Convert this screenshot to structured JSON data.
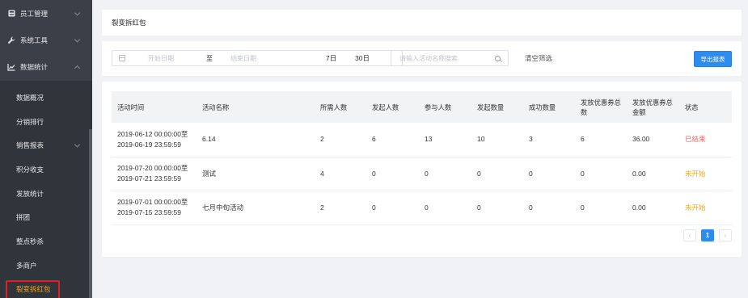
{
  "sidebar": {
    "top_items": [
      {
        "label": "员工管理",
        "icon": "id-card-icon"
      },
      {
        "label": "系统工具",
        "icon": "wrench-icon"
      },
      {
        "label": "数据统计",
        "icon": "chart-icon"
      }
    ],
    "sub_items": [
      {
        "label": "数据概况"
      },
      {
        "label": "分销排行"
      },
      {
        "label": "销售报表"
      },
      {
        "label": "积分收支"
      },
      {
        "label": "发放统计"
      },
      {
        "label": "拼团"
      },
      {
        "label": "整点秒杀"
      },
      {
        "label": "多商户"
      },
      {
        "label": "裂变拆红包"
      }
    ]
  },
  "page_title": "裂变拆红包",
  "filters": {
    "start_placeholder": "开始日期",
    "range_separator": "至",
    "end_placeholder": "结束日期",
    "quick_7": "7日",
    "quick_30": "30日",
    "search_placeholder": "请输入活动名称搜索",
    "clear_label": "清空筛选",
    "export_label": "导出报表"
  },
  "table": {
    "headers": [
      "活动时间",
      "活动名称",
      "所需人数",
      "发起人数",
      "参与人数",
      "发起数量",
      "成功数量",
      "发放优惠券总数",
      "发放优惠券总金额",
      "状态"
    ],
    "rows": [
      {
        "time_start": "2019-06-12 00:00:00至",
        "time_end": "2019-06-19 23:59:59",
        "name": "6.14",
        "required": "2",
        "initiators": "6",
        "participants": "13",
        "launched": "10",
        "success": "3",
        "coupons": "6",
        "amount": "36.00",
        "status": "已结束"
      },
      {
        "time_start": "2019-07-20 00:00:00至",
        "time_end": "2019-07-21 23:59:59",
        "name": "测试",
        "required": "4",
        "initiators": "0",
        "participants": "0",
        "launched": "0",
        "success": "0",
        "coupons": "0",
        "amount": "0.00",
        "status": "未开始"
      },
      {
        "time_start": "2019-07-01 00:00:00至",
        "time_end": "2019-07-15 23:59:59",
        "name": "七月中旬活动",
        "required": "2",
        "initiators": "0",
        "participants": "0",
        "launched": "0",
        "success": "0",
        "coupons": "0",
        "amount": "0.00",
        "status": "未开始"
      }
    ]
  },
  "pagination": {
    "prev": "‹",
    "current": "1",
    "next": "›"
  },
  "colors": {
    "primary": "#2d8cf0",
    "sidebar": "#30353c",
    "active": "#f5a623",
    "ended": "#f56c6c",
    "highlight_border": "#e02020"
  }
}
